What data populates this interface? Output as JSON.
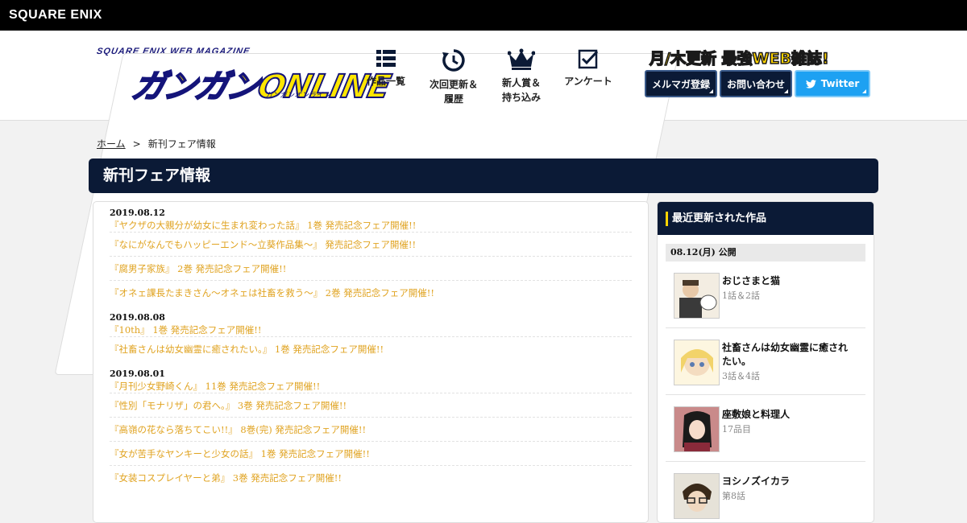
{
  "topbar": {
    "brand": "SQUARE ENIX"
  },
  "header": {
    "logo_sub": "SQUARE ENIX WEB MAGAZINE",
    "logo_main": "ガンガンONLINE",
    "logo_ruby": "ガンガンオンライン",
    "tagline": "月/木更新 最強WEB雑誌!",
    "nav": [
      {
        "label": "作品一覧",
        "icon": "grid-list-icon"
      },
      {
        "label_lines": [
          "次回更新＆",
          "履歴"
        ],
        "icon": "refresh-clock-icon"
      },
      {
        "label_lines": [
          "新人賞＆",
          "持ち込み"
        ],
        "icon": "crown-icon"
      },
      {
        "label": "アンケート",
        "icon": "checkbox-icon"
      }
    ],
    "buttons": {
      "mail": "メルマガ登録",
      "contact": "お問い合わせ",
      "twitter": "Twitter"
    }
  },
  "breadcrumb": {
    "home": "ホーム",
    "separator": ">",
    "current": "新刊フェア情報"
  },
  "page_title": "新刊フェア情報",
  "news": [
    {
      "date": "2019.08.12",
      "items": [
        "『ヤクザの大親分が幼女に生まれ変わった話』 1巻 発売記念フェア開催!!",
        "『なにがなんでもハッピーエンド～立葵作品集～』 発売記念フェア開催!!",
        "『腐男子家族』 2巻 発売記念フェア開催!!",
        "『オネェ課長たまきさん～オネェは社畜を救う～』 2巻 発売記念フェア開催!!"
      ]
    },
    {
      "date": "2019.08.08",
      "items": [
        "『10th』 1巻 発売記念フェア開催!!",
        "『社畜さんは幼女幽霊に癒されたい。』 1巻 発売記念フェア開催!!"
      ]
    },
    {
      "date": "2019.08.01",
      "items": [
        "『月刊少女野崎くん』 11巻 発売記念フェア開催!!",
        "『性別「モナリザ」の君へ。』 3巻 発売記念フェア開催!!",
        "『高嶺の花なら落ちてこい!!』 8巻(完) 発売記念フェア開催!!",
        "『女が苦手なヤンキーと少女の話』 1巻 発売記念フェア開催!!",
        "『女装コスプレイヤーと弟』 3巻 発売記念フェア開催!!"
      ]
    }
  ],
  "sidebar": {
    "heading": "最近更新された作品",
    "date": "08.12(月) 公開",
    "works": [
      {
        "title": "おじさまと猫",
        "eps": "1話＆2話"
      },
      {
        "title": "社畜さんは幼女幽霊に癒されたい。",
        "eps": "3話＆4話"
      },
      {
        "title": "座敷娘と料理人",
        "eps": "17品目"
      },
      {
        "title": "ヨシノズイカラ",
        "eps": "第8話"
      }
    ]
  }
}
